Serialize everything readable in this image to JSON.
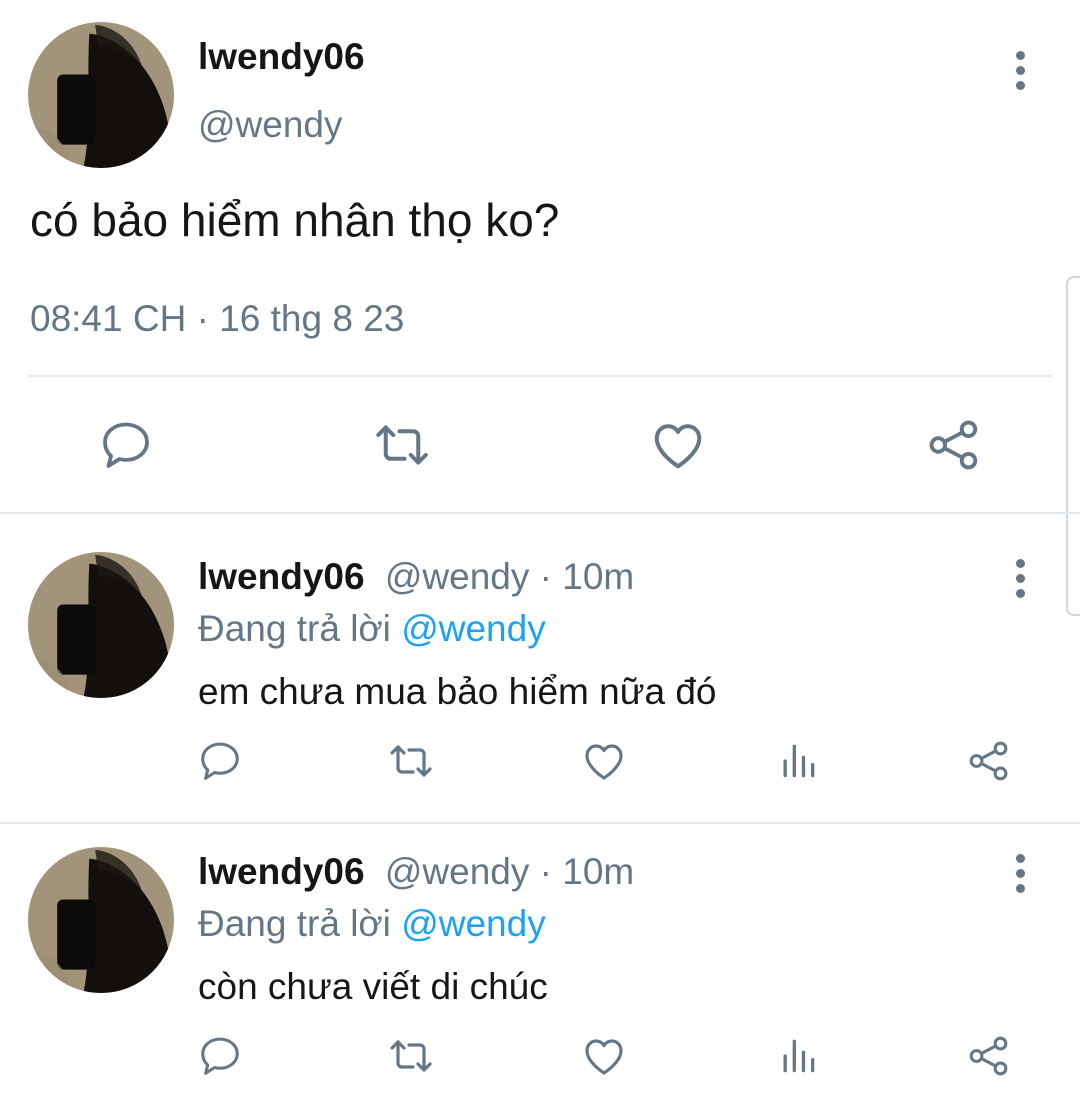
{
  "main_tweet": {
    "display_name": "lwendy06",
    "handle": "@wendy",
    "text": "có bảo hiểm nhân thọ ko?",
    "timestamp": "08:41 CH · 16 thg 8 23",
    "actions": [
      "reply-icon",
      "retweet-icon",
      "like-icon",
      "share-icon"
    ]
  },
  "replies": [
    {
      "display_name": "lwendy06",
      "handle": "@wendy",
      "separator": " · ",
      "time": "10m",
      "replying_label": "Đang trả lời ",
      "replying_to": "@wendy",
      "text": "em chưa mua bảo hiểm nữa đó",
      "actions": [
        "reply-icon",
        "retweet-icon",
        "like-icon",
        "analytics-icon",
        "share-icon"
      ]
    },
    {
      "display_name": "lwendy06",
      "handle": "@wendy",
      "separator": " · ",
      "time": "10m",
      "replying_label": "Đang trả lời ",
      "replying_to": "@wendy",
      "text": "còn chưa viết di chúc",
      "actions": [
        "reply-icon",
        "retweet-icon",
        "like-icon",
        "analytics-icon",
        "share-icon"
      ]
    }
  ],
  "colors": {
    "text_primary": "#14171a",
    "text_secondary": "#657786",
    "link": "#1da1f2",
    "divider": "#e1e8ed"
  }
}
